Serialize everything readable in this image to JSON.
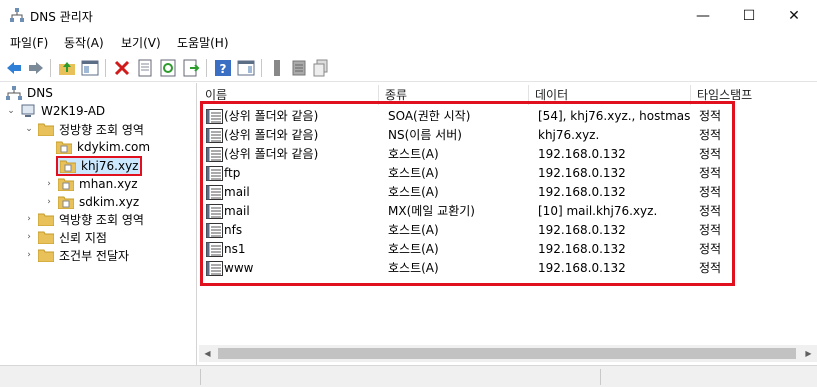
{
  "window": {
    "title": "DNS 관리자",
    "minimize": "—",
    "maximize": "☐",
    "close": "✕"
  },
  "menu": {
    "items": [
      "파일(F)",
      "동작(A)",
      "보기(V)",
      "도움말(H)"
    ]
  },
  "toolbar": {
    "icons": [
      "back-icon",
      "forward-icon",
      "up-folder-icon",
      "show-hide-tree-icon",
      "delete-icon",
      "properties-icon",
      "refresh-icon",
      "export-list-icon",
      "help-icon",
      "action-pane-icon",
      "server-icon",
      "zone-icon",
      "copy-icon"
    ]
  },
  "tree": {
    "root": "DNS",
    "server": "W2K19-AD",
    "forward_zones": "정방향 조회 영역",
    "zones": [
      "kdykim.com",
      "khj76.xyz",
      "mhan.xyz",
      "sdkim.xyz"
    ],
    "reverse_zones": "역방향 조회 영역",
    "trust_points": "신뢰 지점",
    "conditional_forwarders": "조건부 전달자"
  },
  "list": {
    "headers": {
      "name": "이름",
      "type": "종류",
      "data": "데이터",
      "timestamp": "타임스탬프"
    },
    "rows": [
      {
        "name": "(상위 폴더와 같음)",
        "type": "SOA(권한 시작)",
        "data": "[54], khj76.xyz., hostmast...",
        "timestamp": "정적"
      },
      {
        "name": "(상위 폴더와 같음)",
        "type": "NS(이름 서버)",
        "data": "khj76.xyz.",
        "timestamp": "정적"
      },
      {
        "name": "(상위 폴더와 같음)",
        "type": "호스트(A)",
        "data": "192.168.0.132",
        "timestamp": "정적"
      },
      {
        "name": "ftp",
        "type": "호스트(A)",
        "data": "192.168.0.132",
        "timestamp": "정적"
      },
      {
        "name": "mail",
        "type": "호스트(A)",
        "data": "192.168.0.132",
        "timestamp": "정적"
      },
      {
        "name": "mail",
        "type": "MX(메일 교환기)",
        "data": "[10]  mail.khj76.xyz.",
        "timestamp": "정적"
      },
      {
        "name": "nfs",
        "type": "호스트(A)",
        "data": "192.168.0.132",
        "timestamp": "정적"
      },
      {
        "name": "ns1",
        "type": "호스트(A)",
        "data": "192.168.0.132",
        "timestamp": "정적"
      },
      {
        "name": "www",
        "type": "호스트(A)",
        "data": "192.168.0.132",
        "timestamp": "정적"
      }
    ]
  },
  "colors": {
    "highlight": "#e0101e",
    "selection": "#cce8ff",
    "folder": "#e8c15a"
  }
}
